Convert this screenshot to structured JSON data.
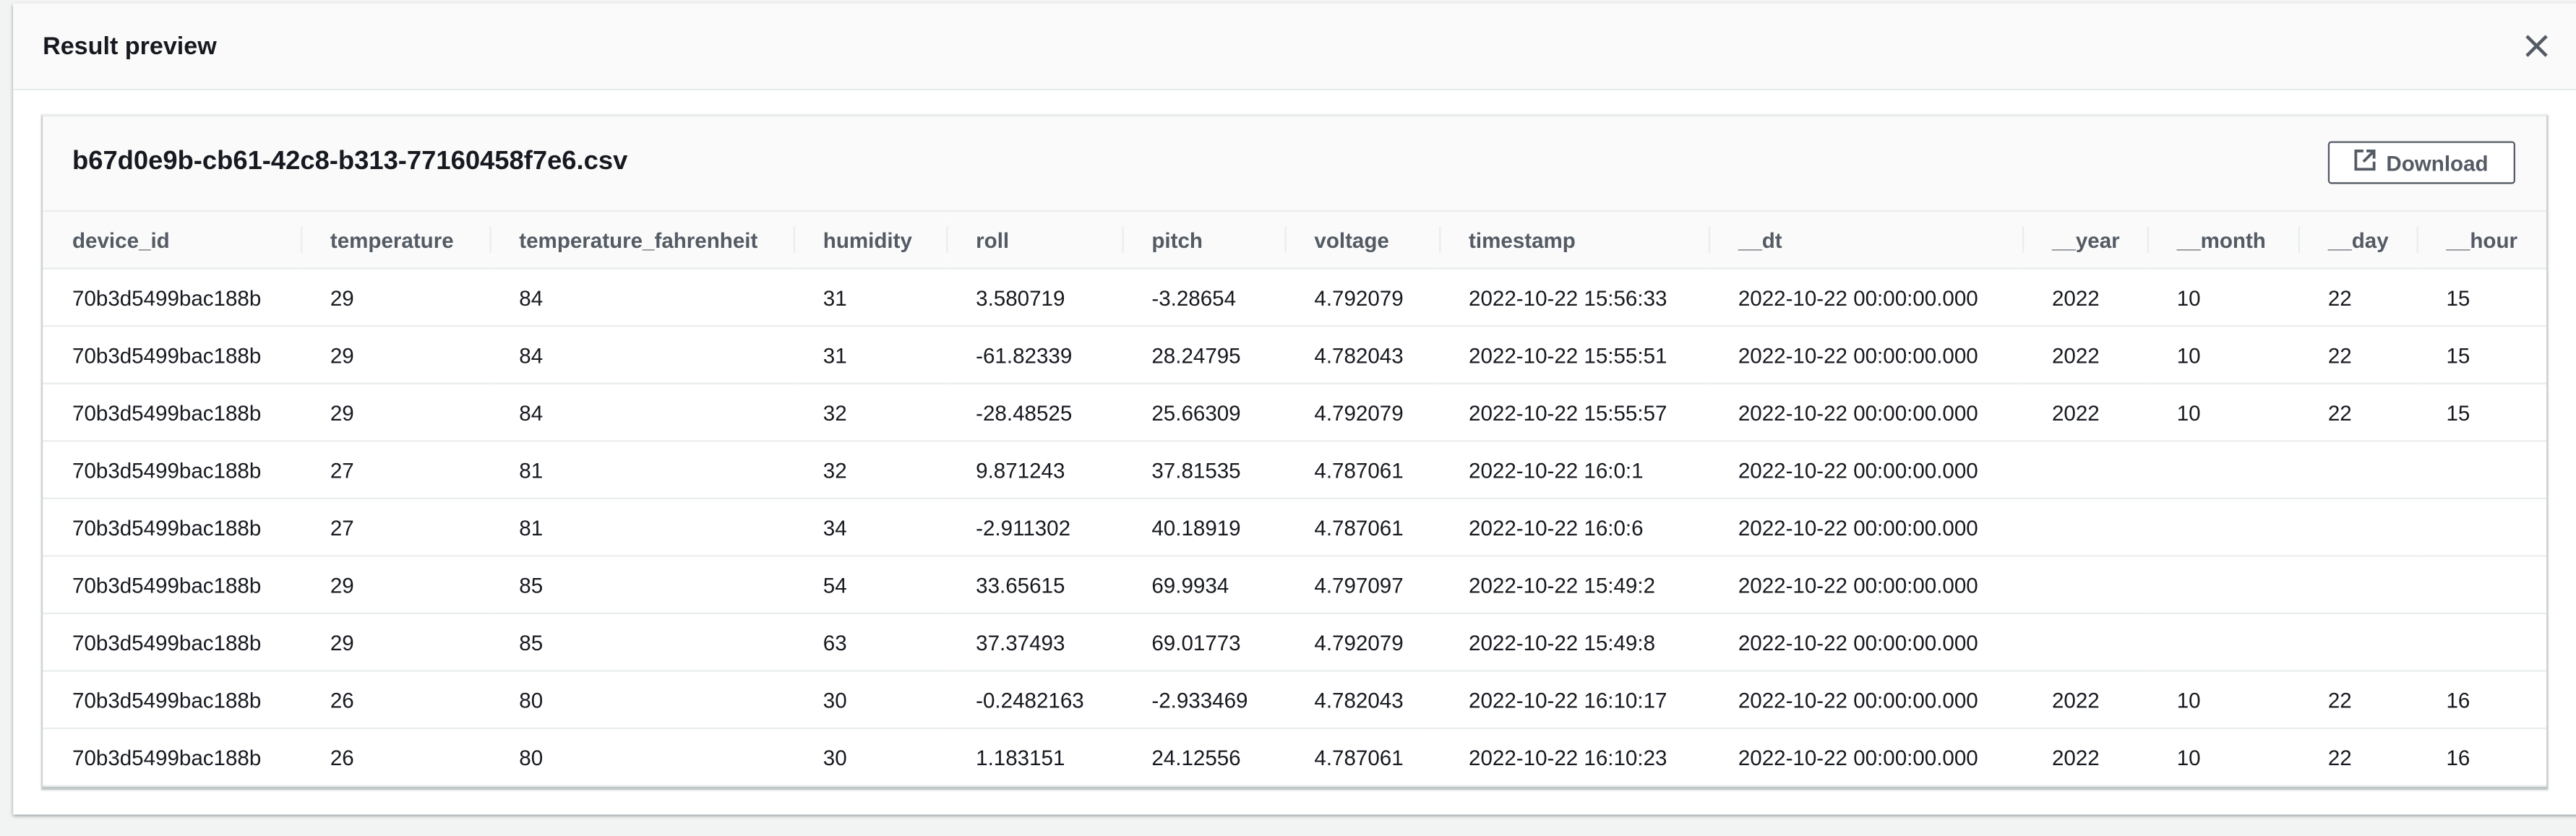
{
  "modal": {
    "title": "Result preview",
    "close_icon": "close-icon"
  },
  "card": {
    "filename": "b67d0e9b-cb61-42c8-b313-77160458f7e6.csv",
    "download_label": "Download",
    "download_icon": "external-link-icon"
  },
  "table": {
    "columns": [
      "device_id",
      "temperature",
      "temperature_fahrenheit",
      "humidity",
      "roll",
      "pitch",
      "voltage",
      "timestamp",
      "__dt",
      "__year",
      "__month",
      "__day",
      "__hour"
    ],
    "rows": [
      [
        "70b3d5499bac188b",
        "29",
        "84",
        "31",
        "3.580719",
        "-3.28654",
        "4.792079",
        "2022-10-22 15:56:33",
        "2022-10-22 00:00:00.000",
        "2022",
        "10",
        "22",
        "15"
      ],
      [
        "70b3d5499bac188b",
        "29",
        "84",
        "31",
        "-61.82339",
        "28.24795",
        "4.782043",
        "2022-10-22 15:55:51",
        "2022-10-22 00:00:00.000",
        "2022",
        "10",
        "22",
        "15"
      ],
      [
        "70b3d5499bac188b",
        "29",
        "84",
        "32",
        "-28.48525",
        "25.66309",
        "4.792079",
        "2022-10-22 15:55:57",
        "2022-10-22 00:00:00.000",
        "2022",
        "10",
        "22",
        "15"
      ],
      [
        "70b3d5499bac188b",
        "27",
        "81",
        "32",
        "9.871243",
        "37.81535",
        "4.787061",
        "2022-10-22 16:0:1",
        "2022-10-22 00:00:00.000",
        "",
        "",
        "",
        ""
      ],
      [
        "70b3d5499bac188b",
        "27",
        "81",
        "34",
        "-2.911302",
        "40.18919",
        "4.787061",
        "2022-10-22 16:0:6",
        "2022-10-22 00:00:00.000",
        "",
        "",
        "",
        ""
      ],
      [
        "70b3d5499bac188b",
        "29",
        "85",
        "54",
        "33.65615",
        "69.9934",
        "4.797097",
        "2022-10-22 15:49:2",
        "2022-10-22 00:00:00.000",
        "",
        "",
        "",
        ""
      ],
      [
        "70b3d5499bac188b",
        "29",
        "85",
        "63",
        "37.37493",
        "69.01773",
        "4.792079",
        "2022-10-22 15:49:8",
        "2022-10-22 00:00:00.000",
        "",
        "",
        "",
        ""
      ],
      [
        "70b3d5499bac188b",
        "26",
        "80",
        "30",
        "-0.2482163",
        "-2.933469",
        "4.782043",
        "2022-10-22 16:10:17",
        "2022-10-22 00:00:00.000",
        "2022",
        "10",
        "22",
        "16"
      ],
      [
        "70b3d5499bac188b",
        "26",
        "80",
        "30",
        "1.183151",
        "24.12556",
        "4.787061",
        "2022-10-22 16:10:23",
        "2022-10-22 00:00:00.000",
        "2022",
        "10",
        "22",
        "16"
      ]
    ]
  }
}
